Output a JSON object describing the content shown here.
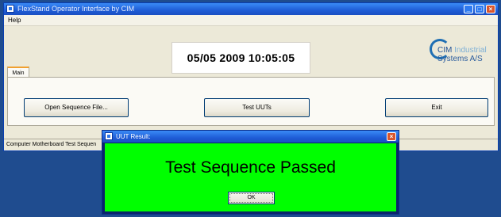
{
  "window": {
    "title": "FlexStand Operator Interface by CIM",
    "menu": {
      "help": "Help"
    },
    "datetime": "05/05 2009  10:05:05",
    "logo": {
      "line1_a": "CIM",
      "line1_b": " Industrial",
      "line2": "Systems A/S"
    },
    "tabs": [
      {
        "label": "Main"
      }
    ],
    "buttons": {
      "open": "Open Sequence File...",
      "test": "Test UUTs",
      "exit": "Exit"
    },
    "status": "Computer Motherboard Test Sequen"
  },
  "dialog": {
    "title": "UUT Result:",
    "message": "Test Sequence Passed",
    "ok": "OK",
    "background": "#00ff00"
  },
  "icons": [
    "app-icon",
    "minimize-icon",
    "maximize-icon",
    "close-icon",
    "cim-logo-icon"
  ]
}
